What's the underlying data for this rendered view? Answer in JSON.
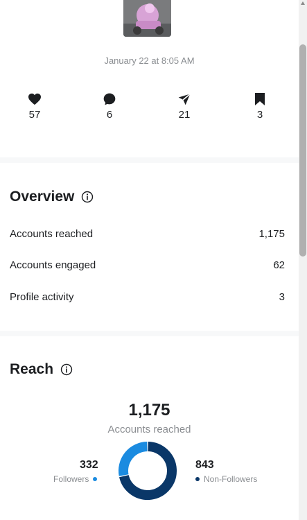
{
  "post": {
    "date": "January 22 at 8:05 AM",
    "stats": [
      {
        "icon": "heart-icon",
        "value": "57"
      },
      {
        "icon": "comment-icon",
        "value": "6"
      },
      {
        "icon": "share-icon",
        "value": "21"
      },
      {
        "icon": "bookmark-icon",
        "value": "3"
      }
    ]
  },
  "overview": {
    "title": "Overview",
    "rows": [
      {
        "label": "Accounts reached",
        "value": "1,175"
      },
      {
        "label": "Accounts engaged",
        "value": "62"
      },
      {
        "label": "Profile activity",
        "value": "3"
      }
    ]
  },
  "reach": {
    "title": "Reach",
    "total": "1,175",
    "total_label": "Accounts reached",
    "followers": {
      "value": "332",
      "label": "Followers",
      "color": "#1b8be0"
    },
    "non_followers": {
      "value": "843",
      "label": "Non-Followers",
      "color": "#0a3768"
    }
  },
  "chart_data": {
    "type": "pie",
    "categories": [
      "Followers",
      "Non-Followers"
    ],
    "values": [
      332,
      843
    ]
  }
}
